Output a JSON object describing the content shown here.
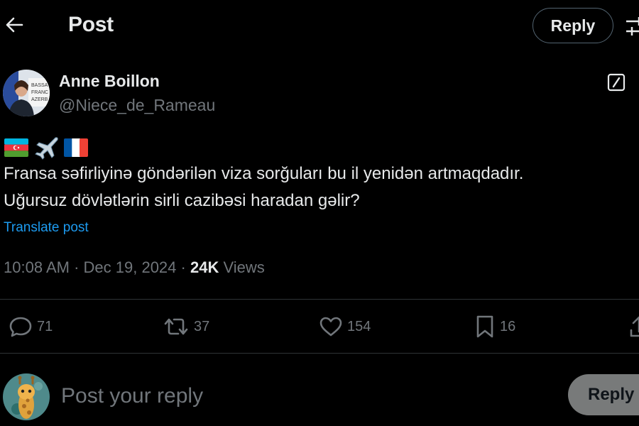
{
  "header": {
    "title": "Post",
    "reply_label": "Reply",
    "back_icon": "arrow-left-icon",
    "settings_icon": "sliders-icon"
  },
  "author": {
    "name": "Anne Boillon",
    "handle": "@Niece_de_Rameau",
    "avatar_icon": "user-avatar"
  },
  "post": {
    "flags": [
      "azerbaijan-flag-icon",
      "airplane-icon",
      "france-flag-icon"
    ],
    "text_line1": "Fransa səfirliyinə göndərilən viza sorğuları bu il yenidən artmaqdadır.",
    "text_line2": "Uğursuz dövlətlərin sirli cazibəsi haradan gəlir?",
    "translate_label": "Translate post",
    "time": "10:08 AM",
    "separator": "·",
    "date": "Dec 19, 2024",
    "views_count": "24K",
    "views_label": "Views"
  },
  "actions": {
    "replies": "71",
    "reposts": "37",
    "likes": "154",
    "bookmarks": "16"
  },
  "composer": {
    "placeholder": "Post your reply",
    "reply_label": "Reply"
  },
  "colors": {
    "background": "#000000",
    "text": "#e7e9ea",
    "secondary_text": "#71767b",
    "link": "#1d9bf0",
    "divider": "#2f3336",
    "disabled_button": "#787a7a"
  }
}
